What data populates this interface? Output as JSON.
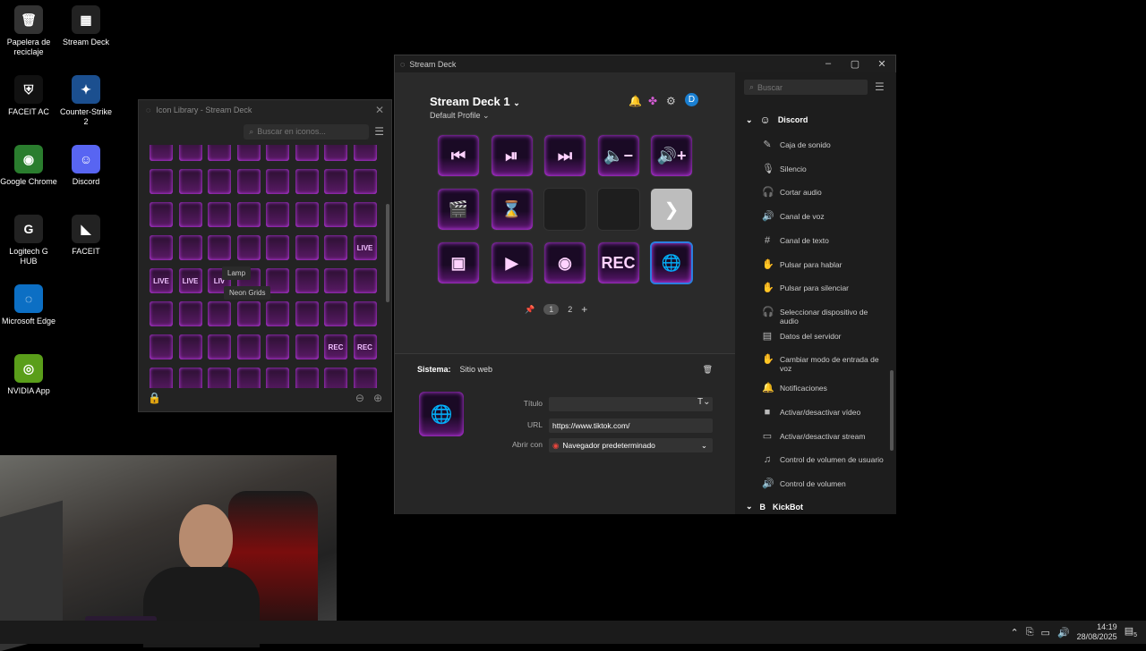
{
  "desktop": {
    "icons": [
      {
        "label": "Papelera de reciclaje",
        "glyph": "🗑",
        "color": "#333"
      },
      {
        "label": "Stream Deck",
        "glyph": "▦",
        "color": "#222"
      },
      {
        "label": "FACEIT AC",
        "glyph": "⛨",
        "color": "#111"
      },
      {
        "label": "Counter-Strike 2",
        "glyph": "✦",
        "color": "#1b4f8f"
      },
      {
        "label": "Google Chrome",
        "glyph": "◉",
        "color": "#2a7d2e"
      },
      {
        "label": "Discord",
        "glyph": "☺",
        "color": "#5865f2"
      },
      {
        "label": "Logitech G HUB",
        "glyph": "G",
        "color": "#222"
      },
      {
        "label": "FACEIT",
        "glyph": "◣",
        "color": "#222"
      },
      {
        "label": "Microsoft Edge",
        "glyph": "◌",
        "color": "#0c6fc4"
      },
      {
        "label": "NVIDIA App",
        "glyph": "◎",
        "color": "#5a9e1a"
      }
    ]
  },
  "taskbar": {
    "time": "14:19",
    "date": "28/08/2025",
    "notifications": "5"
  },
  "icon_library": {
    "title": "Icon Library - Stream Deck",
    "search_placeholder": "Buscar en iconos...",
    "tooltip_lamp": "Lamp",
    "tooltip_pack": "Neon Grids",
    "tiles": [
      "",
      "",
      "",
      "",
      "",
      "",
      "",
      "",
      "",
      "",
      "",
      "",
      "",
      "",
      "",
      "",
      "",
      "",
      "",
      "",
      "",
      "",
      "",
      "",
      "",
      "",
      "",
      "",
      "",
      "",
      "",
      "LIVE",
      "LIVE",
      "LIVE",
      "LIV",
      "",
      "",
      "",
      "",
      "",
      "",
      "",
      "",
      "",
      "",
      "",
      "",
      "",
      "",
      "",
      "",
      "",
      "",
      "",
      "REC",
      "REC",
      "",
      "",
      "",
      "",
      "",
      "",
      "",
      ""
    ]
  },
  "stream_deck": {
    "window_title": "Stream Deck",
    "device": "Stream Deck 1",
    "profile": "Default Profile",
    "avatar": "D",
    "keys": [
      {
        "glyph": "⏮",
        "type": "neon"
      },
      {
        "glyph": "⏯",
        "type": "neon"
      },
      {
        "glyph": "⏭",
        "type": "neon"
      },
      {
        "glyph": "🔈−",
        "type": "neon"
      },
      {
        "glyph": "🔊+",
        "type": "neon"
      },
      {
        "glyph": "🎬",
        "type": "neon"
      },
      {
        "glyph": "⌛",
        "type": "neon"
      },
      {
        "glyph": "",
        "type": "empty"
      },
      {
        "glyph": "",
        "type": "empty"
      },
      {
        "glyph": "❯",
        "type": "grey"
      },
      {
        "glyph": "▣",
        "type": "neon"
      },
      {
        "glyph": "▶",
        "type": "neon"
      },
      {
        "glyph": "◉",
        "type": "neon"
      },
      {
        "glyph": "REC",
        "type": "neon"
      },
      {
        "glyph": "🌐",
        "type": "selected"
      }
    ],
    "pages": [
      "1",
      "2"
    ],
    "inspector": {
      "category": "Sistema:",
      "action": "Sitio web",
      "title_label": "Título",
      "title_value": "",
      "url_label": "URL",
      "url_value": "https://www.tiktok.com/",
      "open_with_label": "Abrir con",
      "open_with_value": "Navegador predeterminado"
    },
    "sidebar": {
      "search_placeholder": "Buscar",
      "category": "Discord",
      "actions": [
        {
          "label": "Caja de sonido",
          "icon": "✎"
        },
        {
          "label": "Silencio",
          "icon": "🎙"
        },
        {
          "label": "Cortar audio",
          "icon": "🎧"
        },
        {
          "label": "Canal de voz",
          "icon": "🔊"
        },
        {
          "label": "Canal de texto",
          "icon": "#"
        },
        {
          "label": "Pulsar para hablar",
          "icon": "✋"
        },
        {
          "label": "Pulsar para silenciar",
          "icon": "✋"
        },
        {
          "label": "Seleccionar dispositivo de audio",
          "icon": "🎧"
        },
        {
          "label": "Datos del servidor",
          "icon": "▤"
        },
        {
          "label": "Cambiar modo de entrada de voz",
          "icon": "✋"
        },
        {
          "label": "Notificaciones",
          "icon": "🔔"
        },
        {
          "label": "Activar/desactivar vídeo",
          "icon": "■"
        },
        {
          "label": "Activar/desactivar stream",
          "icon": "▭"
        },
        {
          "label": "Control de volumen de usuario",
          "icon": "♫"
        },
        {
          "label": "Control de volumen",
          "icon": "🔊"
        }
      ],
      "category2": "KickBot"
    }
  }
}
